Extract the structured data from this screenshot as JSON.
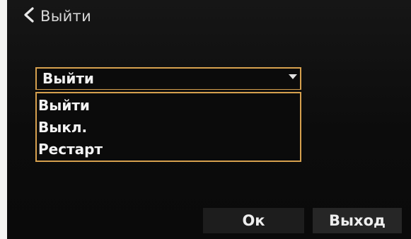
{
  "header": {
    "back_label": "Выйти",
    "back_icon": "chevron-left-icon"
  },
  "dropdown": {
    "selected": "Выйти",
    "caret_icon": "caret-down-icon",
    "options": [
      "Выйти",
      "Выкл.",
      "Рестарт"
    ],
    "accent_color": "#d6a04e"
  },
  "buttons": {
    "ok_label": "Ок",
    "exit_label": "Выход"
  }
}
